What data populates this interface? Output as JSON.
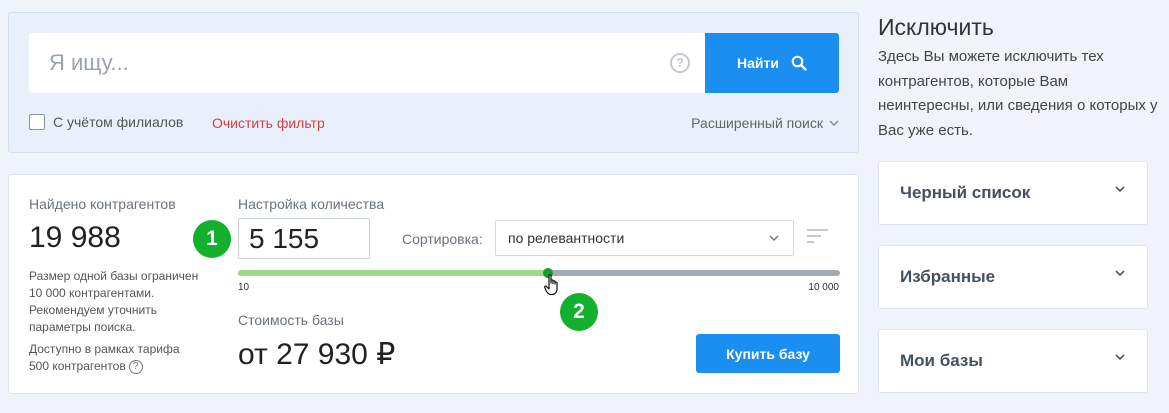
{
  "search": {
    "placeholder": "Я ищу...",
    "button_label": "Найти",
    "branches_label": "С учётом филиалов",
    "clear_filter": "Очистить фильтр",
    "advanced_search": "Расширенный поиск"
  },
  "results": {
    "found_label": "Найдено контрагентов",
    "found_count": "19 988",
    "limit_note_1": "Размер одной базы ограничен",
    "limit_note_2": "10 000 контрагентами.",
    "limit_note_3": "Рекомендуем уточнить",
    "limit_note_4": "параметры поиска.",
    "tariff_note_1": "Доступно в рамках тарифа",
    "tariff_note_2": "500 контрагентов",
    "quantity_label": "Настройка количества",
    "quantity_value": "5 155",
    "sort_label": "Сортировка:",
    "sort_value": "по релевантности",
    "slider_min": "10",
    "slider_max": "10 000",
    "slider_fraction": 0.5145,
    "cost_label": "Стоимость базы",
    "cost_value": "от 27 930 ₽",
    "buy_button": "Купить базу",
    "badge_1": "1",
    "badge_2": "2"
  },
  "exclude": {
    "title": "Исключить",
    "description": "Здесь Вы можете исключить тех контрагентов, которые Вам неинтересны, или сведения о которых у Вас уже есть.",
    "items": [
      {
        "label": "Черный список"
      },
      {
        "label": "Избранные"
      },
      {
        "label": "Мои базы"
      }
    ]
  },
  "colors": {
    "accent": "#1b8ef2",
    "badge": "#13b02e",
    "clear_filter": "#d44040",
    "slider_fill": "#9bdc86"
  },
  "icons": {
    "help": "help-icon",
    "search": "search-icon",
    "chevron": "chevron-down-icon",
    "sort_order": "sort-order-icon",
    "info": "info-icon",
    "cursor": "hand-cursor-icon"
  }
}
